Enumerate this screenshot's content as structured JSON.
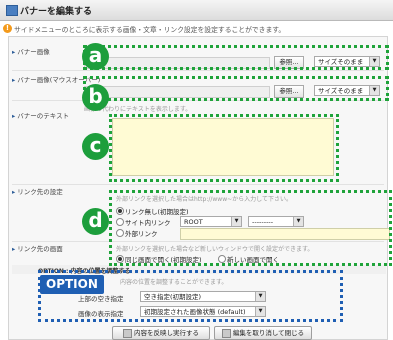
{
  "window": {
    "title": "バナーを編集する"
  },
  "info": {
    "text": "サイドメニューのところに表示する画像・文章・リンク設定を設定することができます。"
  },
  "rows": {
    "banner_image": {
      "label": "バナー画像"
    },
    "banner_image_2": {
      "label": "バナー画像(マウスオーバー)"
    },
    "banner_text": {
      "label": "バナーのテキスト"
    },
    "link_dest": {
      "label": "リンク先の設定"
    },
    "link_window": {
      "label": "リンク先の画面"
    }
  },
  "browse_label": "参照...",
  "size_option": "サイズそのまま",
  "hints": {
    "image2": "画像の表示時にマウスが乗るとサイズが変わる画像を設定します。",
    "text": "画像の代わりにテキストを表示します。",
    "link": "外部リンクを選択した場合はhttp://www~から入力して下さい。",
    "window": "外部リンクを選択した場合など新しいウィンドウで開く設定ができます。",
    "option": "内容の位置を調整することができます。"
  },
  "link_options": [
    {
      "label": "リンク無し(初期設定)",
      "selected": true
    },
    {
      "label": "サイト内リンク",
      "selected": false
    },
    {
      "label": "外部リンク",
      "selected": false
    }
  ],
  "root_select": "ROOT",
  "page_select": "---------",
  "window_options": [
    {
      "label": "同じ画面で開く(初期設定)",
      "selected": true
    },
    {
      "label": "新しい画面で開く",
      "selected": false
    }
  ],
  "option": {
    "header": "OPTION : 内容の位置を調整する",
    "badge": "OPTION",
    "pos_label": "上部の空き指定",
    "pos_value": "空き指定(初期設定)",
    "display_label": "画像の表示指定",
    "display_value": "初期設定された画像状態 (default)"
  },
  "badges": {
    "a": "a",
    "b": "b",
    "c": "c",
    "d": "d"
  },
  "footer": {
    "save_label": "内容を反映し実行する",
    "cancel_label": "編集を取り消して閉じる"
  }
}
